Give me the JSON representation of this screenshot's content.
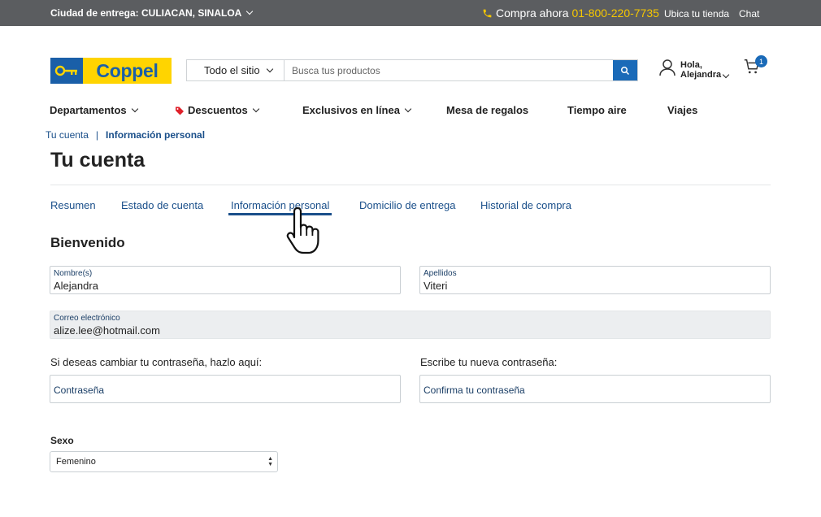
{
  "topbar": {
    "city_label": "Ciudad de entrega: CULIACAN, SINALOA",
    "phone_label": "Compra ahora",
    "phone_number": "01-800-220-7735",
    "store_locator": "Ubica tu tienda",
    "chat": "Chat"
  },
  "header": {
    "logo_text": "Coppel",
    "search_scope": "Todo el sitio",
    "search_placeholder": "Busca tus productos",
    "greeting_line1": "Hola,",
    "greeting_line2": "Alejandra",
    "cart_count": "1"
  },
  "nav": {
    "items": [
      {
        "label": "Departamentos"
      },
      {
        "label": "Descuentos"
      },
      {
        "label": "Exclusivos en línea"
      },
      {
        "label": "Mesa de regalos"
      },
      {
        "label": "Tiempo aire"
      },
      {
        "label": "Viajes"
      }
    ]
  },
  "breadcrumb": {
    "root": "Tu cuenta",
    "separator": "|",
    "current": "Información personal"
  },
  "page": {
    "title": "Tu cuenta",
    "welcome": "Bienvenido"
  },
  "tabs": [
    {
      "label": "Resumen"
    },
    {
      "label": "Estado de cuenta"
    },
    {
      "label": "Información personal",
      "active": true
    },
    {
      "label": "Domicilio de entrega"
    },
    {
      "label": "Historial de compra"
    }
  ],
  "form": {
    "first_name": {
      "label": "Nombre(s)",
      "value": "Alejandra"
    },
    "last_name": {
      "label": "Apellidos",
      "value": "Viteri"
    },
    "email": {
      "label": "Correo electrónico",
      "value": "alize.lee@hotmail.com"
    },
    "password_prompt": "Si deseas cambiar tu contraseña, hazlo aquí:",
    "new_password_prompt": "Escribe tu nueva contraseña:",
    "password_placeholder": "Contraseña",
    "confirm_placeholder": "Confirma tu contraseña",
    "sex_label": "Sexo",
    "sex_value": "Femenino"
  },
  "colors": {
    "topbar_bg": "#5b5d60",
    "phone_accent": "#f6c700",
    "brand_blue": "#1a5fa8",
    "brand_yellow": "#ffd400",
    "link_blue": "#1a4f8a"
  }
}
